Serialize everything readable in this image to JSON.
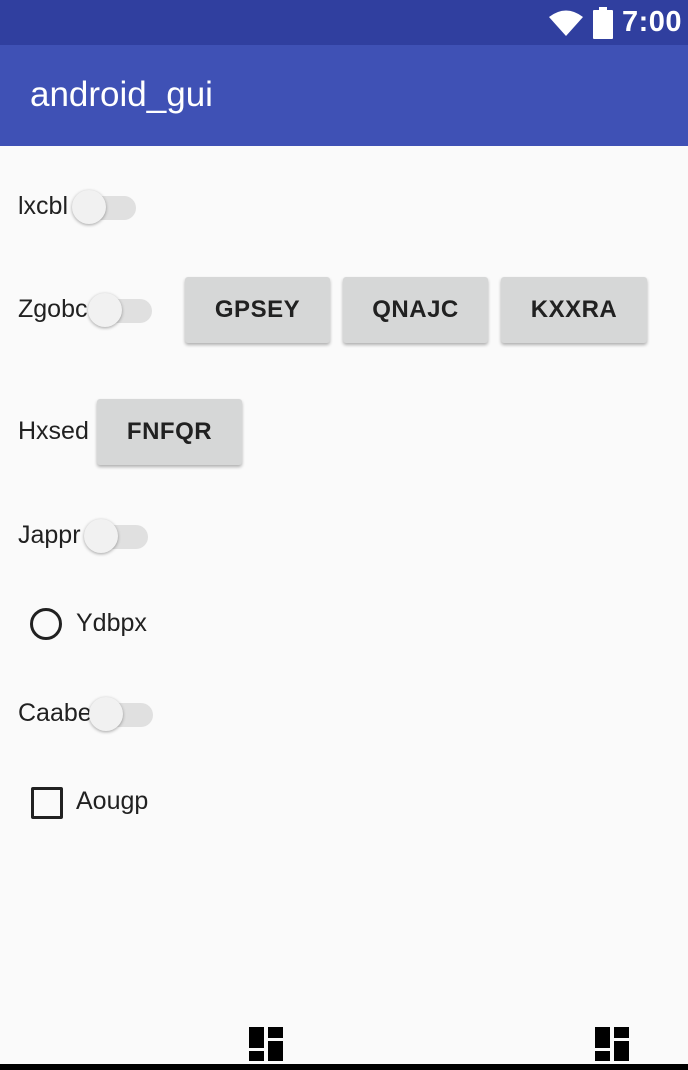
{
  "status_bar": {
    "time": "7:00",
    "icons": [
      "wifi-icon",
      "battery-icon"
    ],
    "background": "#303f9f"
  },
  "app_bar": {
    "title": "android_gui",
    "background": "#3f51b5"
  },
  "rows": {
    "lxcbl": {
      "label": "lxcbl",
      "switch_on": false
    },
    "zgobc": {
      "label": "Zgobc",
      "switch_on": false,
      "buttons": [
        "GPSEY",
        "QNAJC",
        "KXXRA"
      ]
    },
    "hxsed": {
      "label": "Hxsed",
      "button": "FNFQR"
    },
    "jappr": {
      "label": "Jappr",
      "switch_on": false
    },
    "ydbpx": {
      "label": "Ydbpx",
      "checked": false
    },
    "caabe": {
      "label": "Caabe",
      "switch_on": false
    },
    "aougp": {
      "label": "Aougp",
      "checked": false
    }
  },
  "bottom_nav": {
    "icons": [
      "dashboard-icon",
      "dashboard-icon"
    ]
  }
}
